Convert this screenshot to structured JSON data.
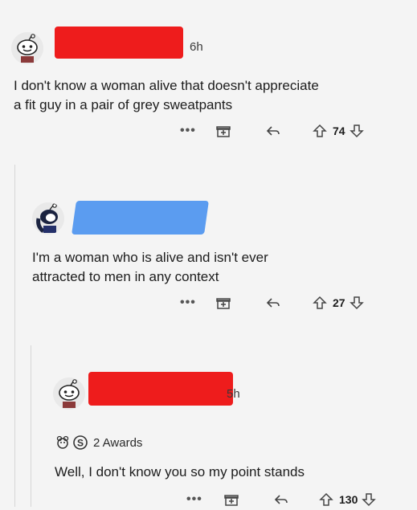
{
  "comments": [
    {
      "username_redaction_color": "#ee1c1c",
      "timestamp": "6h",
      "text_lines": [
        "I don't know a woman alive that doesn't appreciate",
        "a fit guy in a pair of grey sweatpants"
      ],
      "more_label": "•••",
      "votes": "74"
    },
    {
      "username_redaction_color": "#5b9cf0",
      "text_lines": [
        "I'm a woman who is alive and isn't ever",
        "attracted to men in any context"
      ],
      "more_label": "•••",
      "votes": "27"
    },
    {
      "username_redaction_color": "#ee1c1c",
      "timestamp": "5h",
      "awards_label": "2 Awards",
      "text_lines": [
        "Well, I don't know you so my point stands"
      ],
      "more_label": "•••",
      "votes": "130"
    }
  ],
  "icons": [
    "snoo-avatar-icon",
    "gift-award-icon",
    "reply-icon",
    "upvote-icon",
    "downvote-icon",
    "helpful-award-icon",
    "silver-award-icon"
  ]
}
